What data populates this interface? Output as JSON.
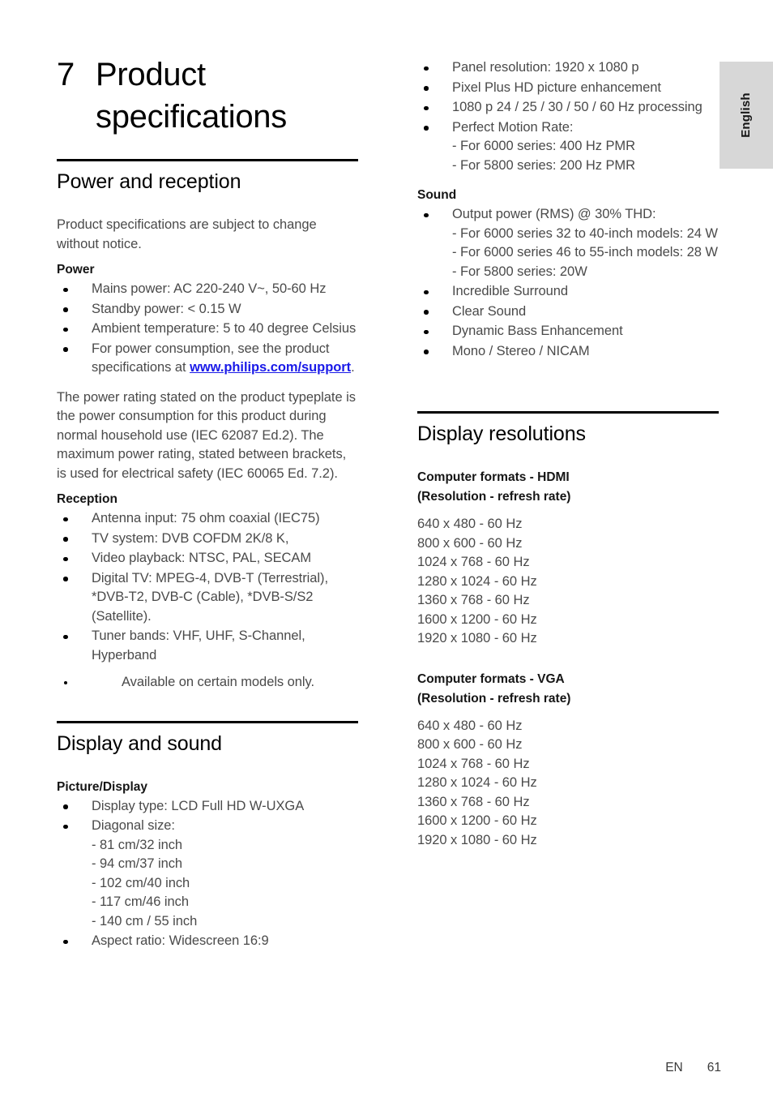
{
  "document": {
    "language_tab": "English",
    "chapter_number": "7",
    "chapter_title": "Product specifications"
  },
  "left_column": {
    "section1": {
      "heading": "Power and reception",
      "intro": "Product specifications are subject to change without notice.",
      "power": {
        "subhead": "Power",
        "items": [
          "Mains power: AC 220-240 V~, 50-60 Hz",
          "Standby power: < 0.15 W",
          "Ambient temperature: 5 to 40 degree Celsius"
        ],
        "consumption_item_prefix": "For power consumption, see the product specifications at ",
        "consumption_link": "www.philips.com/support",
        "consumption_item_suffix": "."
      },
      "rating_paragraph": "The power rating stated on the product typeplate is the power consumption for this product during normal household use (IEC 62087 Ed.2). The maximum power rating, stated between brackets, is used for electrical safety (IEC 60065 Ed. 7.2).",
      "reception": {
        "subhead": "Reception",
        "items": [
          "Antenna input: 75 ohm coaxial (IEC75)",
          "TV system: DVB COFDM 2K/8 K,",
          "Video playback: NTSC, PAL, SECAM",
          "Digital TV: MPEG-4, DVB-T (Terrestrial), *DVB-T2, DVB-C (Cable), *DVB-S/S2 (Satellite).",
          "Tuner bands: VHF, UHF, S-Channel, Hyperband"
        ],
        "note": "Available on certain models only."
      }
    },
    "section2": {
      "heading": "Display and sound",
      "picture_display": {
        "subhead": "Picture/Display",
        "item_display_type": "Display type: LCD Full HD W-UXGA",
        "item_diagonal_label": "Diagonal size:",
        "diagonal_sizes": [
          "- 81 cm/32 inch",
          "- 94 cm/37 inch",
          "- 102 cm/40 inch",
          "- 117 cm/46 inch",
          "- 140 cm / 55 inch"
        ],
        "item_aspect_ratio": "Aspect ratio: Widescreen 16:9"
      }
    }
  },
  "right_column": {
    "picture_continued": {
      "item_panel_resolution": "Panel resolution: 1920 x 1080 p",
      "item_pixel_plus": "Pixel Plus HD picture enhancement",
      "item_processing": "1080 p 24 / 25 / 30 / 50 / 60 Hz processing",
      "item_pmr_label": "Perfect Motion Rate:",
      "pmr_lines": [
        "- For 6000 series: 400 Hz PMR",
        "- For 5800 series: 200 Hz PMR"
      ]
    },
    "sound": {
      "subhead": "Sound",
      "item_output_power_label": "Output power (RMS) @ 30% THD:",
      "output_power_lines": [
        "- For 6000 series 32 to 40-inch models: 24 W",
        "- For 6000 series 46 to 55-inch models: 28 W",
        "- For 5800 series: 20W"
      ],
      "items": [
        "Incredible Surround",
        "Clear Sound",
        "Dynamic Bass Enhancement",
        "Mono / Stereo / NICAM"
      ]
    },
    "display_resolutions": {
      "heading": "Display resolutions",
      "hdmi": {
        "subhead_line1": "Computer formats - HDMI",
        "subhead_line2": "(Resolution - refresh rate)",
        "modes": [
          "640 x 480 - 60 Hz",
          "800 x 600 - 60 Hz",
          "1024 x 768 - 60 Hz",
          "1280 x 1024 - 60 Hz",
          "1360 x 768 - 60 Hz",
          "1600 x 1200 - 60 Hz",
          "1920 x 1080 - 60 Hz"
        ]
      },
      "vga": {
        "subhead_line1": "Computer formats - VGA",
        "subhead_line2": "(Resolution - refresh rate)",
        "modes": [
          "640 x 480 - 60 Hz",
          "800 x 600 - 60 Hz",
          "1024 x 768 - 60 Hz",
          "1280 x 1024 - 60 Hz",
          "1360 x 768 - 60 Hz",
          "1600 x 1200 - 60 Hz",
          "1920 x 1080 - 60 Hz"
        ]
      }
    }
  },
  "footer": {
    "language_code": "EN",
    "page_number": "61"
  },
  "colors": {
    "link": "#1a1ae8",
    "body_text": "#4a4a4a",
    "heading": "#000000",
    "tab_background": "#d7d7d7"
  }
}
